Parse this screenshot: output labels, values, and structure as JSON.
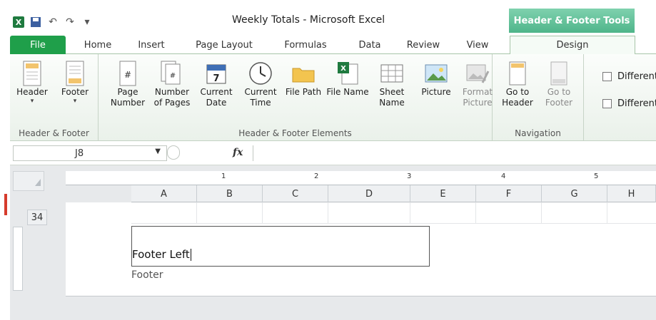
{
  "window": {
    "title": "Weekly Totals - Microsoft Excel",
    "context_tab": "Header & Footer Tools"
  },
  "tabs": [
    "File",
    "Home",
    "Insert",
    "Page Layout",
    "Formulas",
    "Data",
    "Review",
    "View",
    "Design"
  ],
  "ribbon": {
    "groups": {
      "header_footer": "Header & Footer",
      "elements": "Header & Footer Elements",
      "navigation": "Navigation"
    },
    "buttons": {
      "header": "Header",
      "footer": "Footer",
      "page_number": "Page Number",
      "number_of_pages": "Number of Pages",
      "current_date": "Current Date",
      "current_time": "Current Time",
      "file_path": "File Path",
      "file_name": "File Name",
      "sheet_name": "Sheet Name",
      "picture": "Picture",
      "format_picture": "Format Picture",
      "go_to_header": "Go to Header",
      "go_to_footer": "Go to Footer"
    },
    "options": [
      "Different",
      "Different"
    ]
  },
  "formula_bar": {
    "name_box": "J8",
    "fx": "fx",
    "value": ""
  },
  "ruler": [
    "1",
    "2",
    "3",
    "4",
    "5"
  ],
  "columns": [
    "A",
    "B",
    "C",
    "D",
    "E",
    "F",
    "G",
    "H"
  ],
  "row_number": "34",
  "footer": {
    "left_text": "Footer Left",
    "label": "Footer"
  },
  "colors": {
    "file_tab": "#1f9f4a",
    "context_tab": "#4fb58a"
  }
}
